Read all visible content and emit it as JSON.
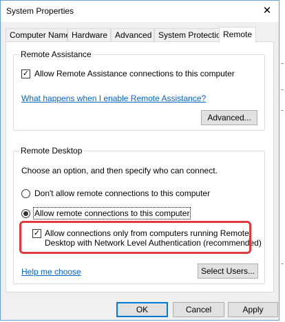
{
  "window": {
    "title": "System Properties",
    "close_glyph": "✕"
  },
  "tabs": [
    {
      "label": "Computer Name"
    },
    {
      "label": "Hardware"
    },
    {
      "label": "Advanced"
    },
    {
      "label": "System Protection"
    },
    {
      "label": "Remote"
    }
  ],
  "remote_assistance": {
    "group_label": "Remote Assistance",
    "checkbox_label": "Allow Remote Assistance connections to this computer",
    "checkbox_checked": true,
    "help_link": "What happens when I enable Remote Assistance?",
    "advanced_button": "Advanced..."
  },
  "remote_desktop": {
    "group_label": "Remote Desktop",
    "instruction": "Choose an option, and then specify who can connect.",
    "option_dont_allow": "Don't allow remote connections to this computer",
    "option_allow": "Allow remote connections to this computer",
    "selected_option": "allow",
    "nla_label_line1": "Allow connections only from computers running Remote",
    "nla_label_line2": "Desktop with Network Level Authentication (recommended)",
    "nla_checked": true,
    "help_link": "Help me choose",
    "select_users_button": "Select Users..."
  },
  "footer": {
    "ok": "OK",
    "cancel": "Cancel",
    "apply": "Apply"
  },
  "colors": {
    "accent": "#0078d7",
    "highlight": "#e0393e",
    "link": "#0066cc"
  }
}
